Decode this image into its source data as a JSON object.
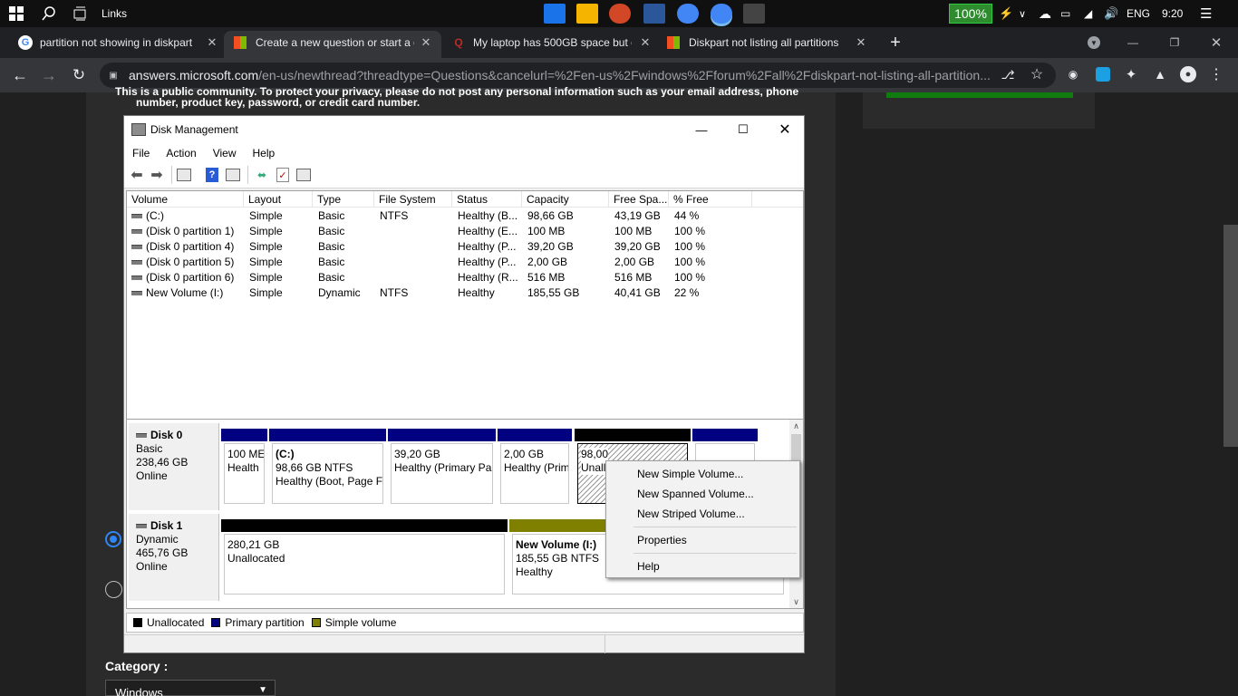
{
  "taskbar": {
    "links_label": "Links",
    "battery": "100%",
    "language": "ENG",
    "time": "9:20"
  },
  "browser": {
    "tabs": [
      {
        "label": "partition not showing in diskpart",
        "icon": "google-icon"
      },
      {
        "label": "Create a new question or start a d",
        "icon": "microsoft-icon"
      },
      {
        "label": "My laptop has 500GB space but o",
        "icon": "quora-icon"
      },
      {
        "label": "Diskpart not listing all partitions",
        "icon": "microsoft-icon"
      }
    ],
    "url_host": "answers.microsoft.com",
    "url_path": "/en-us/newthread?threadtype=Questions&cancelurl=%2Fen-us%2Fwindows%2Fforum%2Fall%2Fdiskpart-not-listing-all-partition..."
  },
  "page": {
    "notice_line1": "This is a public community. To protect your privacy, please do not post any personal information such as your email address, phone",
    "notice_line2": "number, product key, password, or credit card number.",
    "category_label": "Category :",
    "category_value": "Windows"
  },
  "disk_mgmt": {
    "title": "Disk Management",
    "menu": [
      "File",
      "Action",
      "View",
      "Help"
    ],
    "columns": [
      "Volume",
      "Layout",
      "Type",
      "File System",
      "Status",
      "Capacity",
      "Free Spa...",
      "% Free"
    ],
    "volumes": [
      {
        "volume": "(C:)",
        "layout": "Simple",
        "type": "Basic",
        "fs": "NTFS",
        "status": "Healthy (B...",
        "capacity": "98,66 GB",
        "free": "43,19 GB",
        "pct": "44 %"
      },
      {
        "volume": "(Disk 0 partition 1)",
        "layout": "Simple",
        "type": "Basic",
        "fs": "",
        "status": "Healthy (E...",
        "capacity": "100 MB",
        "free": "100 MB",
        "pct": "100 %"
      },
      {
        "volume": "(Disk 0 partition 4)",
        "layout": "Simple",
        "type": "Basic",
        "fs": "",
        "status": "Healthy (P...",
        "capacity": "39,20 GB",
        "free": "39,20 GB",
        "pct": "100 %"
      },
      {
        "volume": "(Disk 0 partition 5)",
        "layout": "Simple",
        "type": "Basic",
        "fs": "",
        "status": "Healthy (P...",
        "capacity": "2,00 GB",
        "free": "2,00 GB",
        "pct": "100 %"
      },
      {
        "volume": "(Disk 0 partition 6)",
        "layout": "Simple",
        "type": "Basic",
        "fs": "",
        "status": "Healthy (R...",
        "capacity": "516 MB",
        "free": "516 MB",
        "pct": "100 %"
      },
      {
        "volume": "New Volume (I:)",
        "layout": "Simple",
        "type": "Dynamic",
        "fs": "NTFS",
        "status": "Healthy",
        "capacity": "185,55 GB",
        "free": "40,41 GB",
        "pct": "22 %"
      }
    ],
    "disk0": {
      "name": "Disk 0",
      "type": "Basic",
      "size": "238,46 GB",
      "state": "Online",
      "parts": [
        {
          "l1": "",
          "l2": "100 ME",
          "l3": "Health"
        },
        {
          "l1": "(C:)",
          "l2": "98,66 GB NTFS",
          "l3": "Healthy (Boot, Page F"
        },
        {
          "l1": "",
          "l2": "39,20 GB",
          "l3": "Healthy (Primary Pa"
        },
        {
          "l1": "",
          "l2": "2,00 GB",
          "l3": "Healthy (Prim"
        },
        {
          "l1": "",
          "l2": "98,00",
          "l3": "Unallo"
        },
        {
          "l1": "",
          "l2": "",
          "l3": ""
        }
      ]
    },
    "disk1": {
      "name": "Disk 1",
      "type": "Dynamic",
      "size": "465,76 GB",
      "state": "Online",
      "parts": [
        {
          "l1": "",
          "l2": "280,21 GB",
          "l3": "Unallocated"
        },
        {
          "l1": "New Volume  (I:)",
          "l2": "185,55 GB NTFS",
          "l3": "Healthy"
        }
      ]
    },
    "legend": [
      "Unallocated",
      "Primary partition",
      "Simple volume"
    ],
    "context_menu": [
      "New Simple Volume...",
      "New Spanned Volume...",
      "New Striped Volume...",
      "Properties",
      "Help"
    ],
    "colors": {
      "unallocated": "#000000",
      "primary": "#000080",
      "simple": "#808000"
    }
  }
}
